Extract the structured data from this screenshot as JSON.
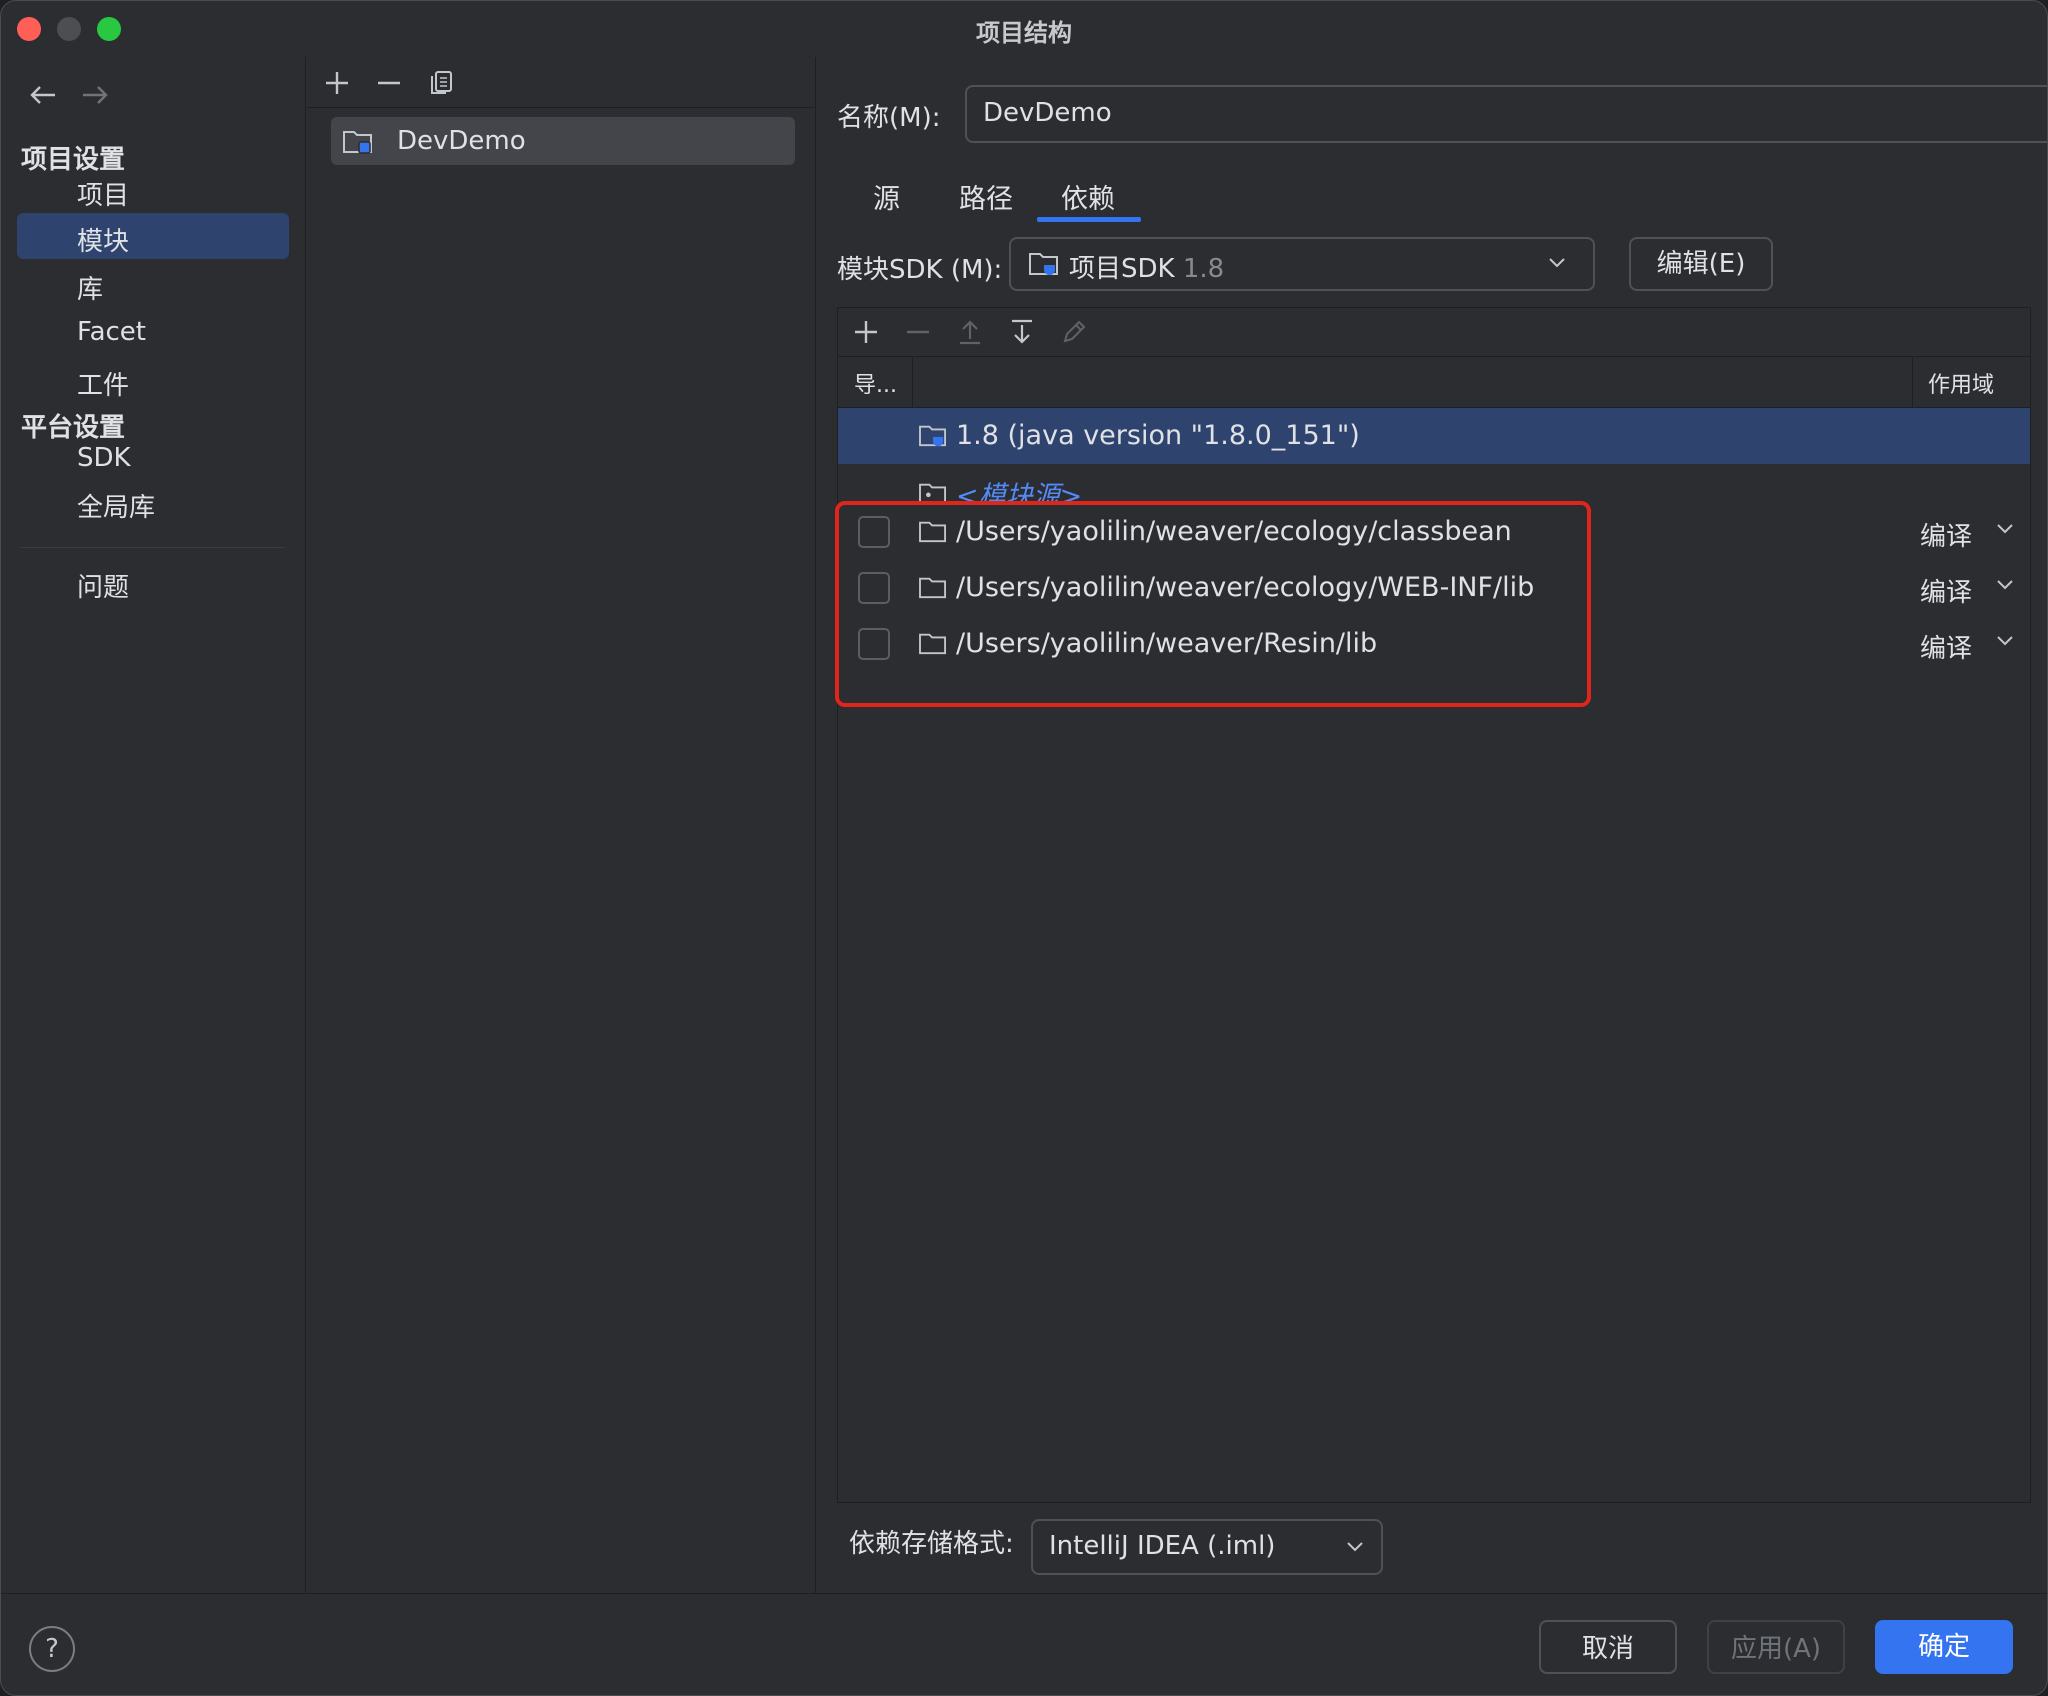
{
  "window": {
    "title": "项目结构"
  },
  "sidebar": {
    "project_settings_title": "项目设置",
    "project_items": [
      {
        "label": "项目",
        "selected": false
      },
      {
        "label": "模块",
        "selected": true
      },
      {
        "label": "库",
        "selected": false
      },
      {
        "label": "Facet",
        "selected": false
      },
      {
        "label": "工件",
        "selected": false
      }
    ],
    "platform_settings_title": "平台设置",
    "platform_items": [
      {
        "label": "SDK"
      },
      {
        "label": "全局库"
      }
    ],
    "problems_label": "问题"
  },
  "modules": {
    "items": [
      {
        "label": "DevDemo"
      }
    ]
  },
  "module": {
    "name_label": "名称(M):",
    "name_value": "DevDemo",
    "tabs": [
      {
        "label": "源",
        "active": false
      },
      {
        "label": "路径",
        "active": false
      },
      {
        "label": "依赖",
        "active": true
      }
    ],
    "sdk_label": "模块SDK (M):",
    "sdk_value": "项目SDK",
    "sdk_version": "1.8",
    "edit_label": "编辑(E)",
    "table": {
      "col_export": "导...",
      "col_scope": "作用域",
      "sdk_row": "1.8 (java version \"1.8.0_151\")",
      "module_source_row": "<模块源>",
      "libraries": [
        {
          "path": "/Users/yaolilin/weaver/ecology/classbean",
          "scope": "编译",
          "exported": false
        },
        {
          "path": "/Users/yaolilin/weaver/ecology/WEB-INF/lib",
          "scope": "编译",
          "exported": false
        },
        {
          "path": "/Users/yaolilin/weaver/Resin/lib",
          "scope": "编译",
          "exported": false
        }
      ]
    },
    "storage_label": "依赖存储格式:",
    "storage_value": "IntelliJ IDEA (.iml)"
  },
  "footer": {
    "help": "?",
    "cancel": "取消",
    "apply": "应用(A)",
    "ok": "确定"
  },
  "colors": {
    "accent": "#3574f0",
    "selection": "#2e436e",
    "highlight_box": "#e0251b",
    "link": "#548af7"
  }
}
